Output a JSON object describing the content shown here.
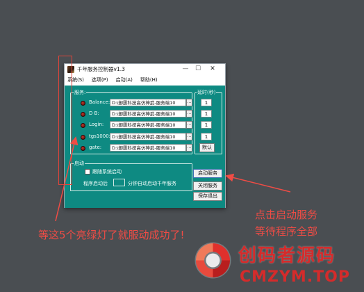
{
  "window": {
    "title": "千年服务控制器v1.3",
    "controls": {
      "minimize": "—",
      "maximize": "☐",
      "close": "✕"
    }
  },
  "menu": [
    "系统(S)",
    "选项(P)",
    "启动(A)",
    "帮助(H)"
  ],
  "services": {
    "group_title": "服务:",
    "rows": [
      {
        "name": "Balance:",
        "path": "D:\\御霆科技高仿神武-服务端10",
        "delay": "1"
      },
      {
        "name": "D B:",
        "path": "D:\\御霆科技高仿神武-服务端10",
        "delay": "1"
      },
      {
        "name": "Login:",
        "path": "D:\\御霆科技高仿神武-服务端10",
        "delay": "1"
      },
      {
        "name": "tgs1000:",
        "path": "D:\\御霆科技高仿神武-服务端10",
        "delay": "1"
      },
      {
        "name": "gate:",
        "path": "D:\\御霆科技高仿神武-服务端10",
        "delay": ""
      }
    ],
    "browse_label": "..."
  },
  "delay_group": {
    "title": "延时(秒)",
    "default_button": "默认"
  },
  "startup_group": {
    "title": "启动",
    "auto_start_label": "跟随系统启动",
    "after_label": "程序启动后",
    "minutes_label": "分钟自动启动千年服务"
  },
  "buttons": {
    "start": "启动服务",
    "stop": "关闭服务",
    "save_exit": "保存退出"
  },
  "annotations": {
    "right_line1": "点击启动服务",
    "right_line2": "等待程序全部",
    "bottom": "等这5个亮绿灯了就服动成功了!"
  },
  "watermark": {
    "cn": "创码者源码",
    "en": "CMZYM.TOP"
  },
  "colors": {
    "background": "#4a4e52",
    "client": "#0e8a82",
    "annotation_red": "#f04c45",
    "watermark_red": "#d52b2b"
  }
}
